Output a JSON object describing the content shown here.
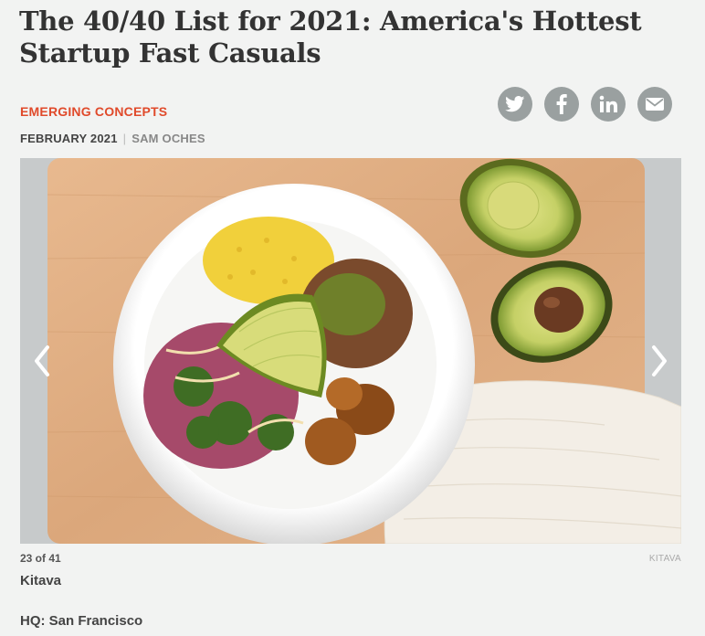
{
  "article": {
    "title": "The 40/40 List for 2021: America's Hottest Startup Fast Casuals",
    "category": "EMERGING CONCEPTS",
    "date": "FEBRUARY 2021",
    "separator": "|",
    "author": "SAM OCHES"
  },
  "share": {
    "icons": [
      "twitter-icon",
      "facebook-icon",
      "linkedin-icon",
      "email-icon"
    ],
    "color": "#9aa0a0"
  },
  "slideshow": {
    "counter": "23 of 41",
    "photo_credit": "KITAVA",
    "slide_title": "Kitava",
    "hq": "HQ: San Francisco",
    "prev_icon": "chevron-left-icon",
    "next_icon": "chevron-right-icon"
  },
  "colors": {
    "accent": "#e04a2b",
    "background": "#f2f3f2"
  }
}
